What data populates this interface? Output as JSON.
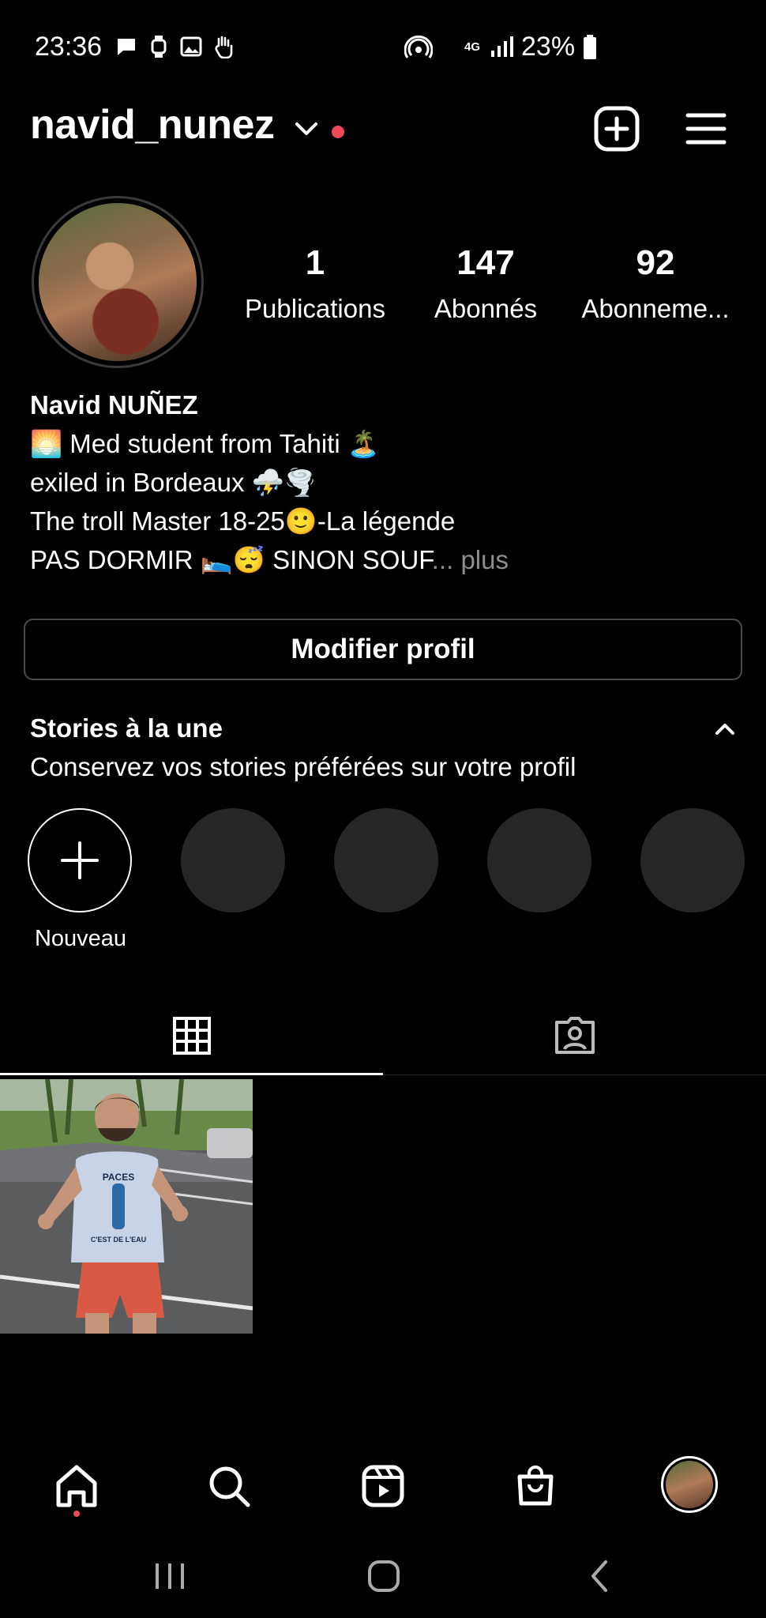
{
  "status_bar": {
    "time": "23:36",
    "network": "4G",
    "battery": "23%"
  },
  "header": {
    "username": "navid_nunez",
    "notification_color": "#ed4956"
  },
  "stats": [
    {
      "value": "1",
      "label": "Publications"
    },
    {
      "value": "147",
      "label": "Abonnés"
    },
    {
      "value": "92",
      "label": "Abonneme..."
    }
  ],
  "bio": {
    "name": "Navid NUÑEZ",
    "line1": "🌅 Med student from Tahiti 🏝️",
    "line2": "exiled in Bordeaux ⛈️🌪️",
    "line3": "The troll Master 18-25🙂-La légende",
    "line4": "PAS DORMIR 🛌😴 SINON SOUF",
    "more": "... plus"
  },
  "edit_profile_label": "Modifier profil",
  "highlights": {
    "title": "Stories à la une",
    "subtitle": "Conservez vos stories préférées sur votre profil",
    "new_label": "Nouveau"
  },
  "post": {
    "shirt_text_top": "PACES",
    "shirt_text_bottom": "C'EST DE L'EAU"
  },
  "icons": {
    "header": [
      "chevron-down-icon",
      "add-post-icon",
      "menu-icon"
    ],
    "tabs": [
      "grid-icon",
      "tagged-icon"
    ],
    "bottom_nav": [
      "home-icon",
      "search-icon",
      "reels-icon",
      "shop-icon",
      "profile-avatar"
    ],
    "system_nav": [
      "recents-icon",
      "home-button-icon",
      "back-icon"
    ]
  },
  "colors": {
    "background": "#000000",
    "accent_red": "#ed4956",
    "placeholder": "#262626",
    "muted_text": "#8e8e8e"
  }
}
